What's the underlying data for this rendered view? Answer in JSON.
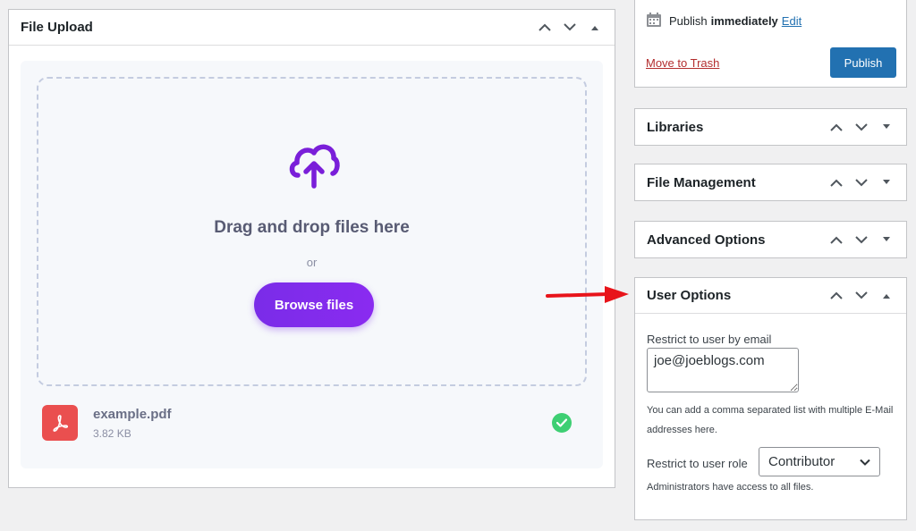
{
  "file_upload": {
    "title": "File Upload",
    "drop_text": "Drag and drop files here",
    "or_text": "or",
    "browse_label": "Browse files",
    "file": {
      "name": "example.pdf",
      "size": "3.82 KB"
    }
  },
  "publish": {
    "label": "Publish",
    "when": "immediately",
    "edit": "Edit",
    "trash": "Move to Trash",
    "button": "Publish"
  },
  "sidebar": {
    "libraries": "Libraries",
    "file_management": "File Management",
    "advanced_options": "Advanced Options",
    "user_options": {
      "title": "User Options",
      "email_label": "Restrict to user by email",
      "email_value": "joe@joeblogs.com",
      "help": "You can add a comma separated list with multiple E-Mail addresses here.",
      "role_label": "Restrict to user role",
      "role_value": "Contributor",
      "admin_note": "Administrators have access to all files."
    }
  },
  "colors": {
    "accent_purple": "#7a2ce8",
    "wp_blue": "#2271b1",
    "trash_red": "#b32d2e",
    "pdf_red": "#ea4f4f",
    "success_green": "#3ecf73",
    "annotation_arrow": "#e8141a"
  },
  "icons": {
    "upload": "cloud-upload-icon",
    "pdf": "pdf-icon",
    "check": "check-circle-icon",
    "calendar": "calendar-icon"
  }
}
